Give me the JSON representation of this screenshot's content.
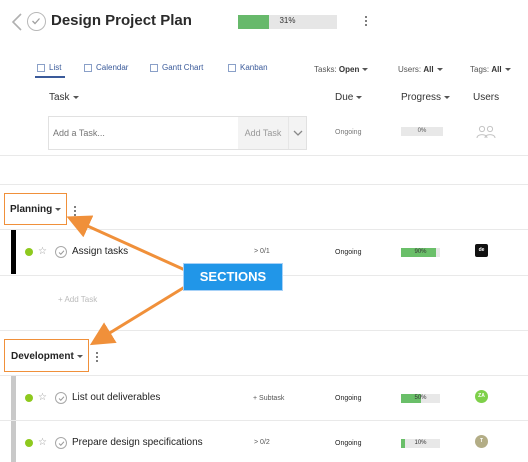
{
  "header": {
    "title": "Design Project Plan",
    "progress_text": "31%",
    "progress_value": 0.31
  },
  "views": {
    "tabs": [
      {
        "label": "List"
      },
      {
        "label": "Calendar"
      },
      {
        "label": "Gantt Chart"
      },
      {
        "label": "Kanban"
      }
    ]
  },
  "filters": {
    "tasks_label": "Tasks:",
    "tasks_value": "Open",
    "users_label": "Users:",
    "users_value": "All",
    "tags_label": "Tags:",
    "tags_value": "All"
  },
  "columns": {
    "task": "Task",
    "due": "Due",
    "progress": "Progress",
    "users": "Users"
  },
  "add_task_row": {
    "placeholder": "Add a Task...",
    "button_label": "Add Task",
    "status": "Ongoing",
    "progress_text": "0%"
  },
  "sections": [
    {
      "name": "Planning",
      "strip_color": "#000000",
      "tasks": [
        {
          "name": "Assign tasks",
          "subtask_info": "0/1",
          "due": "Ongoing",
          "progress_text": "90%",
          "progress_value": 0.9,
          "avatar_text": "de",
          "avatar_color": "#111111"
        }
      ],
      "add_task_label": "+ Add Task"
    },
    {
      "name": "Development",
      "strip_color": "#c9c9c9",
      "tasks": [
        {
          "name": "List out deliverables",
          "subtask_info": "+ Subtask",
          "due": "Ongoing",
          "progress_text": "50%",
          "progress_value": 0.5,
          "avatar_text": "ZA",
          "avatar_color": "#7ed04a"
        },
        {
          "name": "Prepare design specifications",
          "subtask_info": "0/2",
          "due": "Ongoing",
          "progress_text": "10%",
          "progress_value": 0.1,
          "avatar_text": "T",
          "avatar_color": "#b3ad86"
        }
      ]
    }
  ],
  "annotation": {
    "label": "SECTIONS",
    "color": "#2196e8",
    "arrow_color": "#f0903a"
  }
}
